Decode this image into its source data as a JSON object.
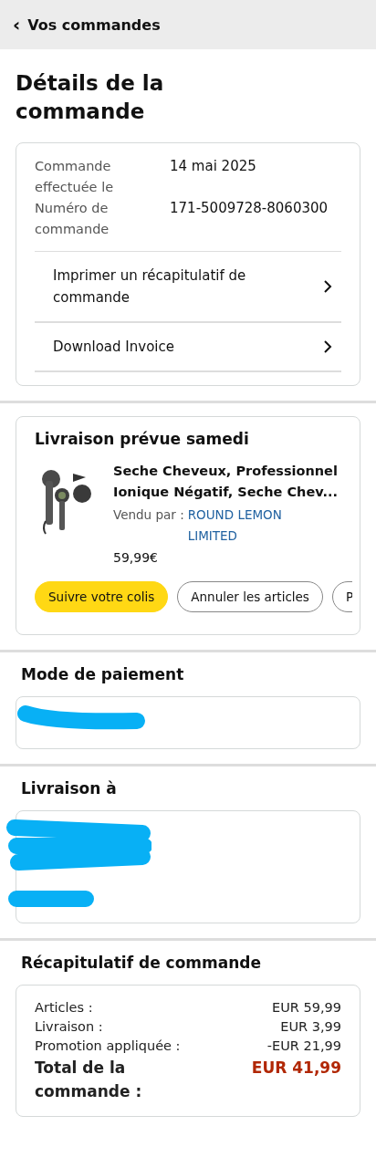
{
  "header": {
    "back_icon": "‹",
    "title": "Vos commandes"
  },
  "page_title": "Détails de la commande",
  "order_info": {
    "rows": [
      {
        "label": "Commande effectuée le",
        "value": "14 mai 2025"
      },
      {
        "label": "Numéro de commande",
        "value": "171-5009728-8060300"
      }
    ],
    "links": [
      {
        "label": "Imprimer un récapitulatif de commande"
      },
      {
        "label": "Download Invoice"
      }
    ]
  },
  "shipment": {
    "title": "Livraison prévue samedi",
    "product": {
      "name": "Seche Cheveux, Professionnel Ionique Négatif, Seche Chev...",
      "sold_by_label": "Vendu par  :",
      "seller": "ROUND LEMON LIMITED",
      "price": "59,99€"
    },
    "buttons": [
      {
        "label": "Suivre votre colis",
        "kind": "primary"
      },
      {
        "label": "Annuler les articles",
        "kind": "outline"
      },
      {
        "label": "P",
        "kind": "cut"
      }
    ]
  },
  "payment": {
    "title": "Mode de paiement",
    "redacted": true
  },
  "delivery": {
    "title": "Livraison à",
    "redacted": true
  },
  "summary": {
    "title": "Récapitulatif de commande",
    "rows": [
      {
        "label": "Articles :",
        "value": "EUR 59,99",
        "kind": "line"
      },
      {
        "label": "Livraison :",
        "value": "EUR 3,99",
        "kind": "line"
      },
      {
        "label": "Promotion appliquée :",
        "value": "-EUR 21,99",
        "kind": "line"
      },
      {
        "label": "Total de la commande :",
        "value": "EUR 41,99",
        "kind": "total"
      }
    ]
  }
}
